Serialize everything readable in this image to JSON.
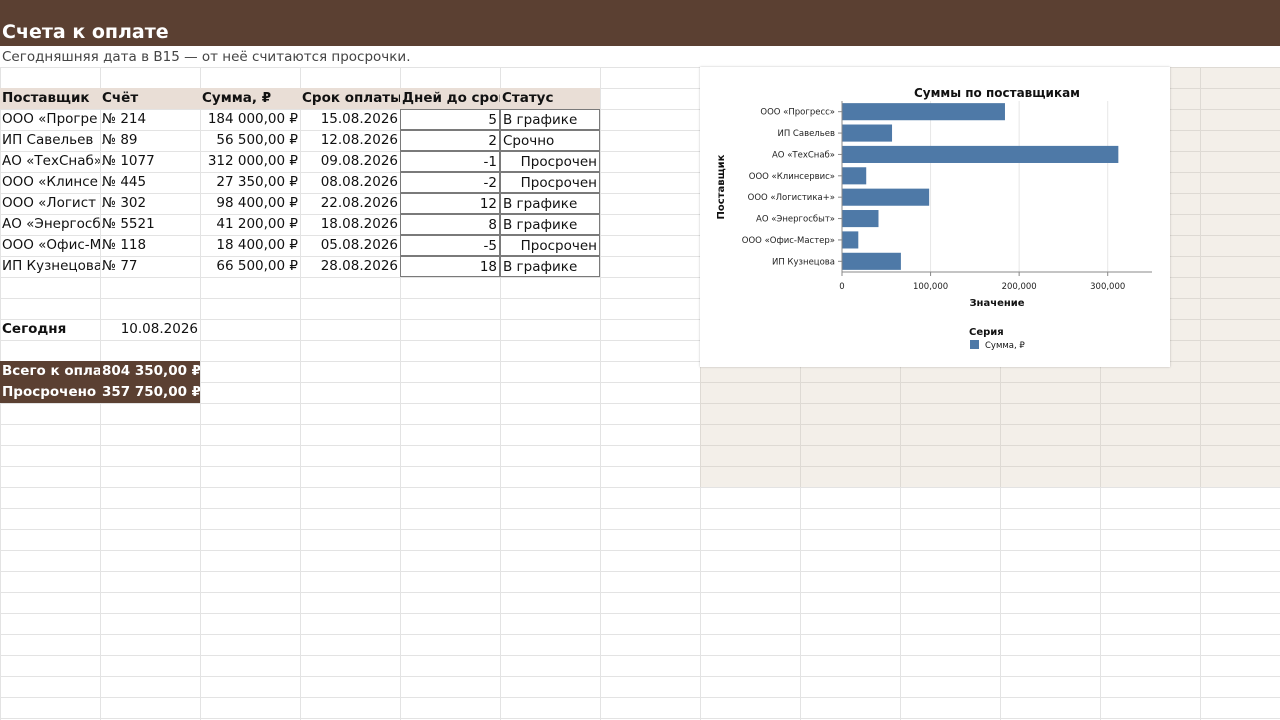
{
  "title": "Счета к оплате",
  "subtitle": "Сегодняшняя дата в B15 — от неё считаются просрочки.",
  "table": {
    "headers": [
      "Поставщик",
      "Счёт",
      "Сумма, ₽",
      "Срок оплаты",
      "Дней до срок",
      "Статус"
    ],
    "rows": [
      {
        "supplier": "ООО «Прогре",
        "invoice": "№ 214",
        "amount": "184 000,00 ₽",
        "due": "15.08.2026",
        "days": "5",
        "status": "В графике",
        "status_align": "left"
      },
      {
        "supplier": "ИП Савельев",
        "invoice": "№ 89",
        "amount": "56 500,00 ₽",
        "due": "12.08.2026",
        "days": "2",
        "status": "Срочно",
        "status_align": "left"
      },
      {
        "supplier": "АО «ТехСнаб»",
        "invoice": "№ 1077",
        "amount": "312 000,00 ₽",
        "due": "09.08.2026",
        "days": "-1",
        "status": "Просрочен",
        "status_align": "right"
      },
      {
        "supplier": "ООО «Клинсе",
        "invoice": "№ 445",
        "amount": "27 350,00 ₽",
        "due": "08.08.2026",
        "days": "-2",
        "status": "Просрочен",
        "status_align": "right"
      },
      {
        "supplier": "ООО «Логист",
        "invoice": "№ 302",
        "amount": "98 400,00 ₽",
        "due": "22.08.2026",
        "days": "12",
        "status": "В графике",
        "status_align": "left"
      },
      {
        "supplier": "АО «Энергосб",
        "invoice": "№ 5521",
        "amount": "41 200,00 ₽",
        "due": "18.08.2026",
        "days": "8",
        "status": "В графике",
        "status_align": "left"
      },
      {
        "supplier": "ООО «Офис-М",
        "invoice": "№ 118",
        "amount": "18 400,00 ₽",
        "due": "05.08.2026",
        "days": "-5",
        "status": "Просрочен",
        "status_align": "right"
      },
      {
        "supplier": "ИП Кузнецова",
        "invoice": "№ 77",
        "amount": "66 500,00 ₽",
        "due": "28.08.2026",
        "days": "18",
        "status": "В графике",
        "status_align": "left"
      }
    ]
  },
  "today": {
    "label": "Сегодня",
    "value": "10.08.2026"
  },
  "totals": {
    "total_label": "Всего к опла",
    "total_value": "804 350,00 ₽",
    "overdue_label": "Просрочено",
    "overdue_value": "357 750,00 ₽"
  },
  "colors": {
    "bar": "#4e79a7",
    "header_bg": "#e9ded6",
    "dark_brown": "#5b4032"
  },
  "chart_data": {
    "type": "bar",
    "orientation": "horizontal",
    "title": "Суммы по поставщикам",
    "xlabel": "Значение",
    "ylabel": "Поставщик",
    "categories": [
      "ООО «Прогресс»",
      "ИП Савельев",
      "АО «ТехСнаб»",
      "ООО «Клинсервис»",
      "ООО «Логистика+»",
      "АО «Энергосбыт»",
      "ООО «Офис-Мастер»",
      "ИП Кузнецова"
    ],
    "series": [
      {
        "name": "Сумма, ₽",
        "values": [
          184000,
          56500,
          312000,
          27350,
          98400,
          41200,
          18400,
          66500
        ]
      }
    ],
    "xlim": [
      0,
      350000
    ],
    "xticks": [
      0,
      100000,
      200000,
      300000
    ],
    "xtick_labels": [
      "0",
      "100,000",
      "200,000",
      "300,000"
    ],
    "legend_title": "Серия",
    "legend_position": "bottom",
    "grid": true
  }
}
